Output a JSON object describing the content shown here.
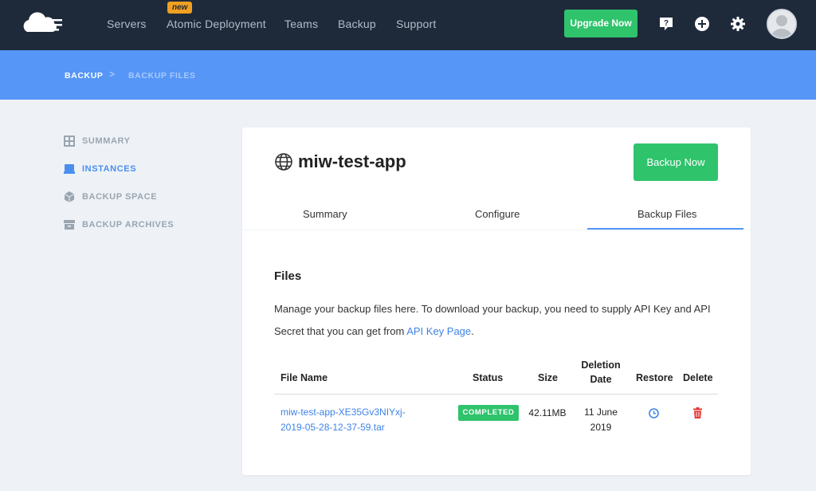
{
  "nav": {
    "items": [
      "Servers",
      "Atomic Deployment",
      "Teams",
      "Backup",
      "Support"
    ],
    "new_badge": "new",
    "upgrade_label": "Upgrade Now"
  },
  "breadcrumb": {
    "items": [
      "BACKUP",
      "BACKUP FILES"
    ],
    "separator": ">"
  },
  "sidebar": {
    "items": [
      {
        "label": "SUMMARY",
        "icon": "grid-icon",
        "active": false
      },
      {
        "label": "INSTANCES",
        "icon": "drive-icon",
        "active": true
      },
      {
        "label": "BACKUP SPACE",
        "icon": "cube-icon",
        "active": false
      },
      {
        "label": "BACKUP ARCHIVES",
        "icon": "archive-icon",
        "active": false
      }
    ]
  },
  "app": {
    "title": "miw-test-app",
    "backup_now_label": "Backup Now"
  },
  "tabs": [
    "Summary",
    "Configure",
    "Backup Files"
  ],
  "active_tab": "Backup Files",
  "files": {
    "title": "Files",
    "desc_before": "Manage your backup files here. To download your backup, you need to supply API Key and API Secret that you can get from ",
    "desc_link": "API Key Page",
    "desc_after": ".",
    "columns": {
      "file_name": "File Name",
      "status": "Status",
      "size": "Size",
      "deletion_date_1": "Deletion",
      "deletion_date_2": "Date",
      "restore": "Restore",
      "delete": "Delete"
    },
    "rows": [
      {
        "file_name_1": "miw-test-app-XE35Gv3NIYxj-",
        "file_name_2": "2019-05-28-12-37-59.tar",
        "status": "COMPLETED",
        "size": "42.11MB",
        "deletion_date_1": "11 June",
        "deletion_date_2": "2019"
      }
    ]
  },
  "colors": {
    "navbar": "#1e2a3a",
    "band": "#5596f7",
    "accent_green": "#2fc36c",
    "link_blue": "#3f83e8",
    "delete_red": "#e53935"
  }
}
